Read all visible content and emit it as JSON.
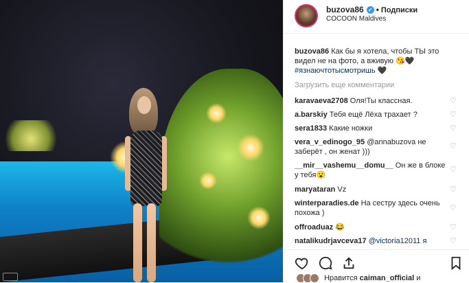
{
  "post": {
    "username": "buzova86",
    "follow_label": "Подписки",
    "separator": "•",
    "location": "COCOON Maldives",
    "caption_user": "buzova86",
    "caption_text": "Как бы я хотела, чтобы ТЫ это видел не на фото, а вживую 😘🖤",
    "caption_tag": "#язнаючтотысмотришь",
    "caption_emoji": "🖤",
    "load_more": "Загрузить еще комментарии",
    "likes_prefix": "Нравится",
    "likes_user": "caiman_official",
    "likes_suffix": "и"
  },
  "comments": [
    {
      "user": "karavaeva2708",
      "text": "Оля!Ты классная."
    },
    {
      "user": "a.barskiy",
      "text": "Тебя ещё Лёха трахает ?"
    },
    {
      "user": "sera1833",
      "text": "Какие ножки"
    },
    {
      "user": "vera_v_edinogo_95",
      "text": "@annabuzova не заберёт , он женат )))"
    },
    {
      "user": "__mir__vashemu__domu__",
      "text": "Он же в блоке у тебя😮"
    },
    {
      "user": "maryataran",
      "text": "Vz"
    },
    {
      "user": "winterparadies.de",
      "text": "На сестру здесь очень похожа )"
    },
    {
      "user": "offroaduaz",
      "text": "😂"
    },
    {
      "user": "natalikudrjavceva17",
      "text": "@victoria12011 я"
    }
  ],
  "colors": {
    "link": "#003569",
    "verified": "#3897f0",
    "muted": "#999999"
  },
  "icons": [
    "verified-badge-icon",
    "heart-icon",
    "comment-icon",
    "share-icon",
    "bookmark-icon"
  ]
}
